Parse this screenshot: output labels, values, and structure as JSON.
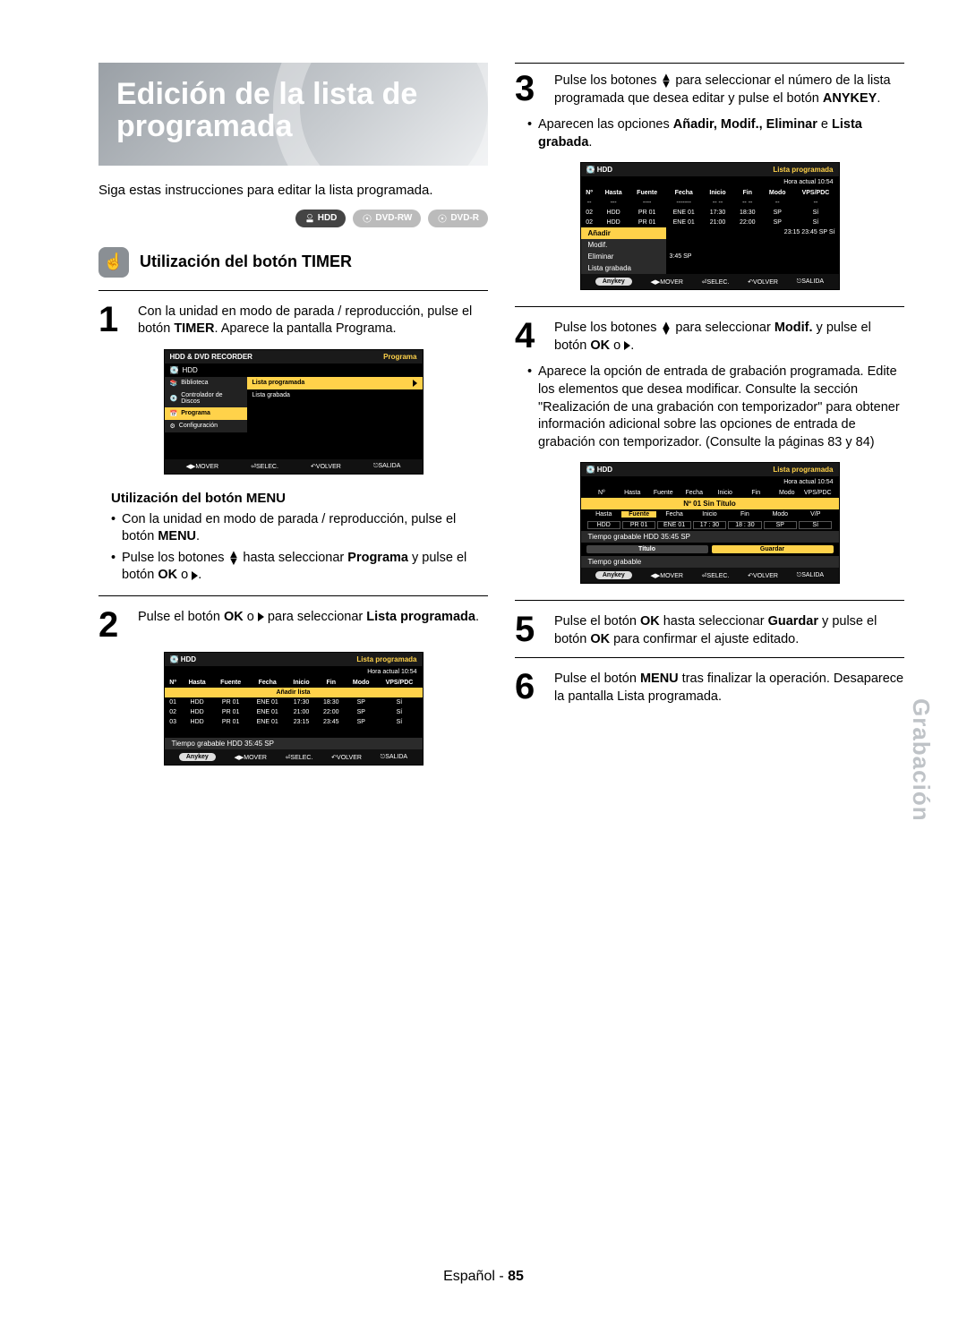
{
  "page_title_1": "Edición de la lista de",
  "page_title_2": "programada",
  "intro": "Siga estas instrucciones para editar la lista programada.",
  "media": {
    "hdd": "HDD",
    "rw": "DVD-RW",
    "r": "DVD-R"
  },
  "section_timer": "Utilización del botón TIMER",
  "step1": {
    "pre": "Con la unidad en modo de parada / reproducción, pulse el botón ",
    "b1": "TIMER",
    "post": ". Aparece la pantalla Programa."
  },
  "osd1": {
    "header": "HDD & DVD RECORDER",
    "header_r": "Programa",
    "device": "HDD",
    "left": [
      "Biblioteca",
      "Controlador de Discos",
      "Programa",
      "Configuración"
    ],
    "right": [
      "Lista programada",
      "Lista grabada"
    ],
    "foot": [
      "MOVER",
      "SELEC.",
      "VOLVER",
      "SALIDA"
    ]
  },
  "menu_head": "Utilización del botón MENU",
  "menu_b1": "Con la unidad en modo de parada / reproducción, pulse el botón ",
  "menu_b1_bold": "MENU",
  "menu_b2_a": "Pulse los botones ",
  "menu_b2_b": " hasta seleccionar ",
  "menu_b2_bold": "Programa",
  "menu_b2_c": " y pulse el botón ",
  "menu_b2_bold2": "OK",
  "menu_b2_d": " o ",
  "step2": {
    "a": "Pulse el botón ",
    "b": "OK",
    "c": " o ",
    "d": " para seleccionar ",
    "e": "Lista programada",
    "f": "."
  },
  "osd2": {
    "device": "HDD",
    "title": "Lista programada",
    "time": "Hora actual 10:54",
    "cols": [
      "Nº",
      "Hasta",
      "Fuente",
      "Fecha",
      "Inicio",
      "Fin",
      "Modo",
      "VPS/PDC"
    ],
    "add": "Añadir lista",
    "rows": [
      [
        "01",
        "HDD",
        "PR 01",
        "ENE 01",
        "17:30",
        "18:30",
        "SP",
        "Sí"
      ],
      [
        "02",
        "HDD",
        "PR 01",
        "ENE 01",
        "21:00",
        "22:00",
        "SP",
        "Sí"
      ],
      [
        "03",
        "HDD",
        "PR 01",
        "ENE 01",
        "23:15",
        "23:45",
        "SP",
        "Sí"
      ]
    ],
    "rec": "Tiempo grabable    HDD  35:45 SP",
    "anykey": "Anykey",
    "foot": [
      "MOVER",
      "SELEC.",
      "VOLVER",
      "SALIDA"
    ]
  },
  "step3": {
    "a": "Pulse los botones ",
    "b": " para seleccionar el número de la lista programada que desea editar y pulse el botón ",
    "c": "ANYKEY",
    "d": "."
  },
  "step3_b": {
    "pre": "Aparecen las opciones ",
    "b": "Añadir, Modif., Eliminar",
    "post": " e ",
    "b2": "Lista grabada",
    "post2": "."
  },
  "osd3": {
    "device": "HDD",
    "title": "Lista programada",
    "time": "Hora actual 10:54",
    "cols": [
      "Nº",
      "Hasta",
      "Fuente",
      "Fecha",
      "Inicio",
      "Fin",
      "Modo",
      "VPS/PDC"
    ],
    "dash": [
      "--",
      "---",
      "----",
      "-------",
      "-- --",
      "-- --",
      "--",
      "--"
    ],
    "rows": [
      [
        "02",
        "HDD",
        "PR 01",
        "ENE 01",
        "17:30",
        "18:30",
        "SP",
        "Sí"
      ],
      [
        "02",
        "HDD",
        "PR 01",
        "ENE 01",
        "21:00",
        "22:00",
        "SP",
        "Sí"
      ]
    ],
    "ops": [
      "Añadir",
      "Modif.",
      "Eliminar",
      "Lista grabada"
    ],
    "time2": "23:15   23:45   SP    Sí",
    "rec": "3:45 SP",
    "anykey": "Anykey",
    "foot": [
      "MOVER",
      "SELEC.",
      "VOLVER",
      "SALIDA"
    ]
  },
  "step4": {
    "a": "Pulse los botones ",
    "b": " para seleccionar ",
    "c": "Modif.",
    "d": " y pulse el botón ",
    "e": "OK",
    "f": " o ",
    "g": "."
  },
  "step4_bul": "Aparece la opción de entrada de grabación programada. Edite los elementos que desea modificar. Consulte la sección \"Realización de una grabación con temporizador\" para obtener información adicional sobre las opciones de entrada de grabación con temporizador. (Consulte la páginas 83 y 84)",
  "osd4": {
    "device": "HDD",
    "title": "Lista programada",
    "time": "Hora actual 10:54",
    "cols": [
      "Nº",
      "Hasta",
      "Fuente",
      "Fecha",
      "Inicio",
      "Fin",
      "Modo",
      "VPS/PDC"
    ],
    "sin": "Nº 01 Sin Título",
    "h2": [
      "Hasta",
      "Fuente",
      "Fecha",
      "Inicio",
      "Fin",
      "Modo",
      "V/P"
    ],
    "row": [
      "HDD",
      "PR 01",
      "ENE 01",
      "17 : 30",
      "18 : 30",
      "SP",
      "Sí"
    ],
    "btns": [
      "Título",
      "Guardar"
    ],
    "rec": "Tiempo grabable    HDD  35:45 SP",
    "rec2": "Tiempo grabable",
    "anykey": "Anykey",
    "foot": [
      "MOVER",
      "SELEC.",
      "VOLVER",
      "SALIDA"
    ]
  },
  "step5": {
    "a": "Pulse el botón ",
    "b": "OK",
    "c": " hasta seleccionar ",
    "d": "Guardar",
    "e": " y pulse el botón ",
    "f": "OK",
    "g": " para confirmar el ajuste editado."
  },
  "step6": {
    "a": "Pulse el botón ",
    "b": "MENU",
    "c": " tras finalizar la operación. Desaparece la pantalla Lista programada."
  },
  "side": "Grabación",
  "footer_lang": "Español",
  "footer_sep": " - ",
  "footer_page": "85"
}
